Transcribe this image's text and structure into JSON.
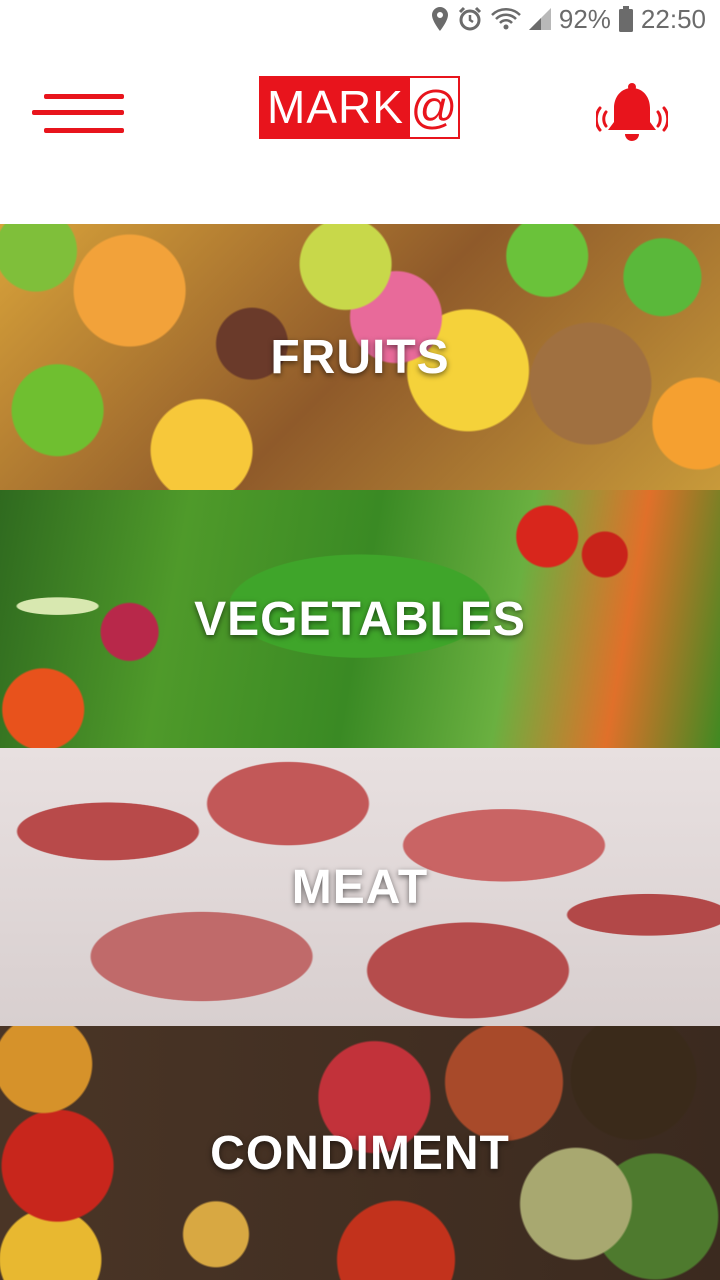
{
  "status_bar": {
    "battery": "92%",
    "time": "22:50",
    "icons": [
      "location-icon",
      "alarm-icon",
      "wifi-icon",
      "signal-icon",
      "battery-icon"
    ]
  },
  "header": {
    "menu_icon": "hamburger-menu-icon",
    "logo": {
      "main": "MARK",
      "suffix": "@"
    },
    "notification_icon": "bell-ringing-icon"
  },
  "categories": [
    {
      "label": "FRUITS"
    },
    {
      "label": "VEGETABLES"
    },
    {
      "label": "MEAT"
    },
    {
      "label": "CONDIMENT"
    }
  ],
  "colors": {
    "accent": "#e8141c",
    "status_text": "#6b6b6b",
    "label_text": "#ffffff"
  }
}
